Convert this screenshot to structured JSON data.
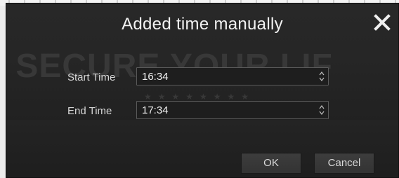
{
  "dialog": {
    "title": "Added time manually",
    "watermark": "E SECURE YOUR LIF",
    "watermark_stars": "★★★★★★★★",
    "close_icon": "close-icon"
  },
  "form": {
    "start_time": {
      "label": "Start Time",
      "value": "16:34"
    },
    "end_time": {
      "label": "End Time",
      "value": "17:34"
    }
  },
  "buttons": {
    "ok_label": "OK",
    "cancel_label": "Cancel"
  },
  "colors": {
    "dialog_bg": "#262626",
    "text": "#f2f2f2",
    "field_border": "#5a5a5a"
  }
}
